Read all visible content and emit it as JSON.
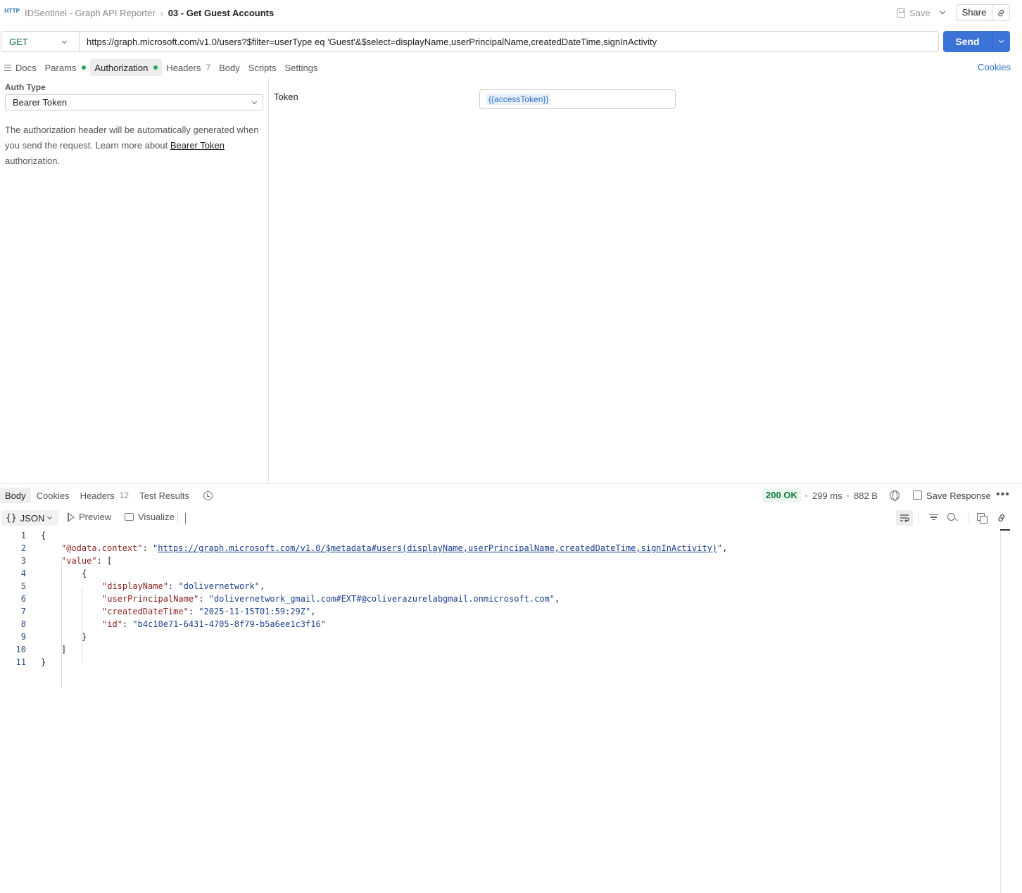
{
  "header": {
    "method_icon": "HTTP",
    "breadcrumb_parent": "IDSentinel - Graph API Reporter",
    "breadcrumb_current": "03 - Get Guest Accounts",
    "save_label": "Save",
    "share_label": "Share"
  },
  "request": {
    "method": "GET",
    "url": "https://graph.microsoft.com/v1.0/users?$filter=userType eq 'Guest'&$select=displayName,userPrincipalName,createdDateTime,signInActivity",
    "send_label": "Send"
  },
  "request_tabs": {
    "docs": "Docs",
    "params": "Params",
    "authorization": "Authorization",
    "headers": "Headers",
    "headers_count": "7",
    "body": "Body",
    "scripts": "Scripts",
    "settings": "Settings",
    "cookies": "Cookies"
  },
  "auth": {
    "type_label": "Auth Type",
    "type_value": "Bearer Token",
    "desc_prefix": "The authorization header will be automatically generated when you send the request. Learn more about ",
    "desc_link": "Bearer Token",
    "desc_suffix": " authorization.",
    "token_label": "Token",
    "token_value": "{{accessToken}}"
  },
  "response_tabs": {
    "body": "Body",
    "cookies": "Cookies",
    "headers": "Headers",
    "headers_count": "12",
    "test_results": "Test Results"
  },
  "response_meta": {
    "status": "200 OK",
    "time": "299 ms",
    "size": "882 B",
    "save_response": "Save Response"
  },
  "body_toolbar": {
    "format": "JSON",
    "preview": "Preview",
    "visualize": "Visualize"
  },
  "response_body": {
    "lines": [
      {
        "n": "1",
        "indent": 0,
        "parts": [
          [
            "punc",
            "{"
          ]
        ]
      },
      {
        "n": "2",
        "indent": 1,
        "parts": [
          [
            "key",
            "\"@odata.context\""
          ],
          [
            "punc",
            ": "
          ],
          [
            "str",
            "\""
          ],
          [
            "url",
            "https://graph.microsoft.com/v1.0/$metadata#users(displayName,userPrincipalName,createdDateTime,signInActivity)"
          ],
          [
            "str",
            "\""
          ],
          [
            "punc",
            ","
          ]
        ]
      },
      {
        "n": "3",
        "indent": 1,
        "parts": [
          [
            "key",
            "\"value\""
          ],
          [
            "punc",
            ": ["
          ]
        ]
      },
      {
        "n": "4",
        "indent": 2,
        "parts": [
          [
            "punc",
            "{"
          ]
        ]
      },
      {
        "n": "5",
        "indent": 3,
        "parts": [
          [
            "key",
            "\"displayName\""
          ],
          [
            "punc",
            ": "
          ],
          [
            "str",
            "\"dolivernetwork\""
          ],
          [
            "punc",
            ","
          ]
        ]
      },
      {
        "n": "6",
        "indent": 3,
        "parts": [
          [
            "key",
            "\"userPrincipalName\""
          ],
          [
            "punc",
            ": "
          ],
          [
            "str",
            "\"dolivernetwork_gmail.com#EXT#@coliverazurelabgmail.onmicrosoft.com\""
          ],
          [
            "punc",
            ","
          ]
        ]
      },
      {
        "n": "7",
        "indent": 3,
        "parts": [
          [
            "key",
            "\"createdDateTime\""
          ],
          [
            "punc",
            ": "
          ],
          [
            "str",
            "\"2025-11-15T01:59:29Z\""
          ],
          [
            "punc",
            ","
          ]
        ]
      },
      {
        "n": "8",
        "indent": 3,
        "parts": [
          [
            "key",
            "\"id\""
          ],
          [
            "punc",
            ": "
          ],
          [
            "str",
            "\"b4c10e71-6431-4705-8f79-b5a6ee1c3f16\""
          ]
        ]
      },
      {
        "n": "9",
        "indent": 2,
        "parts": [
          [
            "punc",
            "}"
          ]
        ]
      },
      {
        "n": "10",
        "indent": 1,
        "parts": [
          [
            "punc",
            "]"
          ]
        ]
      },
      {
        "n": "11",
        "indent": 0,
        "parts": [
          [
            "punc",
            "}"
          ]
        ]
      }
    ]
  }
}
